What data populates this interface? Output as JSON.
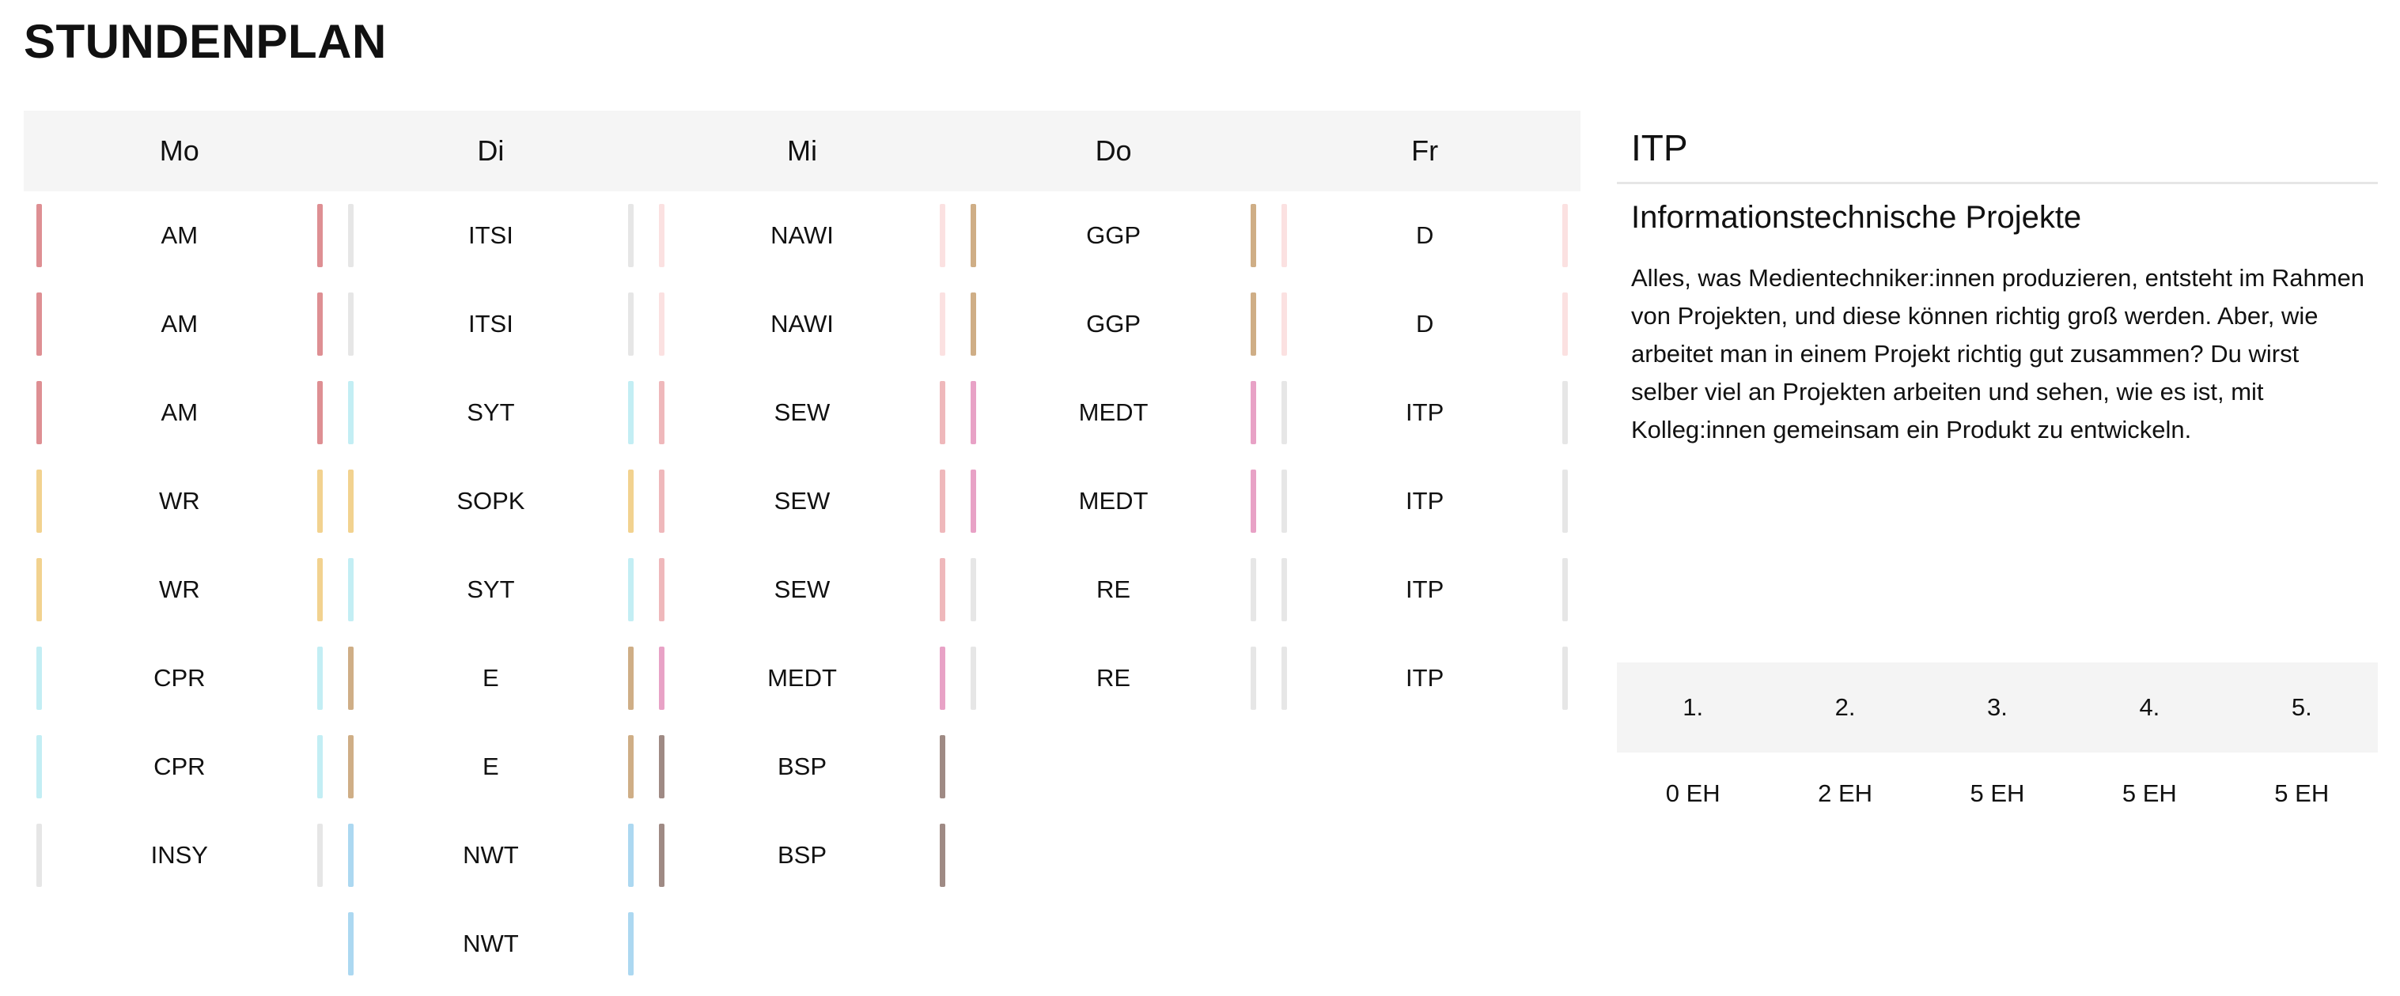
{
  "title": "STUNDENPLAN",
  "days": [
    "Mo",
    "Di",
    "Mi",
    "Do",
    "Fr"
  ],
  "colors": {
    "AM": "#de8f93",
    "ITSI": "#e6e6e6",
    "NAWI": "#fbe1e1",
    "GGP": "#cfae86",
    "D": "#fbe1e1",
    "SYT": "#c3eef4",
    "SEW": "#efb8bb",
    "MEDT": "#e8a2c6",
    "ITP": "#e6e6e6",
    "WR": "#f2d28f",
    "SOPK": "#f2d28f",
    "RE": "#e6e6e6",
    "CPR": "#c3eef4",
    "E": "#cfae86",
    "BSP": "#9f8a84",
    "INSY": "#e6e6e6",
    "NWT": "#acd8f1"
  },
  "schedule": [
    [
      "AM",
      "AM",
      "AM",
      "WR",
      "WR",
      "CPR",
      "CPR",
      "INSY"
    ],
    [
      "ITSI",
      "ITSI",
      "SYT",
      "SOPK",
      "SYT",
      "E",
      "E",
      "NWT",
      "NWT"
    ],
    [
      "NAWI",
      "NAWI",
      "SEW",
      "SEW",
      "SEW",
      "MEDT",
      "BSP",
      "BSP"
    ],
    [
      "GGP",
      "GGP",
      "MEDT",
      "MEDT",
      "RE",
      "RE"
    ],
    [
      "D",
      "D",
      "ITP",
      "ITP",
      "ITP",
      "ITP"
    ]
  ],
  "detail": {
    "code": "ITP",
    "name": "Informationstechnische Projekte",
    "description": "Alles, was Medientechniker:innen produzieren, entsteht im Rahmen von Projekten, und diese können richtig groß werden. Aber, wie arbeitet man in einem Projekt richtig gut zusammen? Du wirst selber viel an Projekten arbeiten und sehen, wie es ist, mit Kolleg:innen gemeinsam ein Produkt zu entwickeln.",
    "years": [
      "1.",
      "2.",
      "3.",
      "4.",
      "5."
    ],
    "hours": [
      "0 EH",
      "2 EH",
      "5 EH",
      "5 EH",
      "5 EH"
    ]
  }
}
